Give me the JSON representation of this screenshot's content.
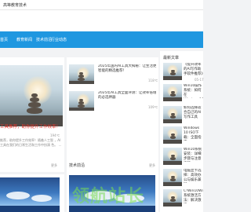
{
  "header": {
    "site_title": "高等教育技术"
  },
  "nav": {
    "items": [
      {
        "label": "首页"
      },
      {
        "label": "教育新闻"
      },
      {
        "label": "技术前沿"
      },
      {
        "label": "行业动态"
      }
    ]
  },
  "featured": {
    "title": "工具推荐，助你提升工作效率！",
    "views": "194℃",
    "excerpt": "推荐，助你提升工作效率！随着人工智 ，AI工具在我们的日常生活和工作中扮演 色。 …",
    "more_label": "更多"
  },
  "news": [
    {
      "title": "2025年国内AI工具大揭秘：让生活更智能的精选推荐！",
      "views": "118℃"
    },
    {
      "title": "2025年AI工具全面评测：让效率倍增的必选神器",
      "views": "109℃"
    }
  ],
  "sidebar": {
    "heading": "最新文章",
    "items": [
      {
        "title": "《提升效率的AI写作助手软件推荐》",
        "date": "05-17"
      },
      {
        "title": "Win10操作系统：如何在Windows10系统中..."
      },
      {
        "title": "如何选择适合自己的AI写作工具"
      },
      {
        "title": "Windows 10 ISO下载：全面指南..."
      },
      {
        "title": "Win10系统安装：详细步骤与注意事项"
      },
      {
        "title": "电脑显卡选择：高效办公与娱乐兼顾"
      },
      {
        "title": "C!Win10Win10系统激活方法：解决激活..."
      }
    ]
  },
  "tech_section": {
    "heading": "技术前沿",
    "more_label": "更多"
  },
  "watermark": "领航站长"
}
